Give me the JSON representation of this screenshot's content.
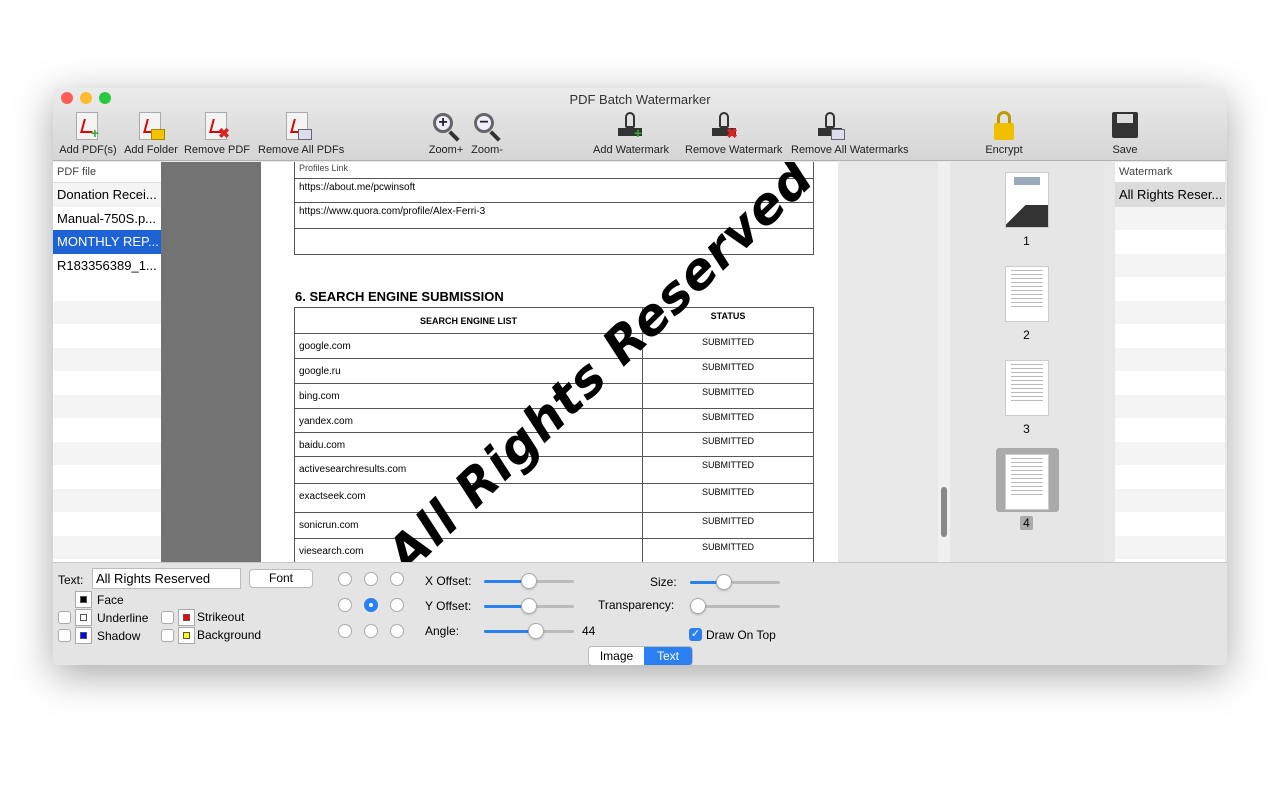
{
  "window": {
    "title": "PDF Batch Watermarker"
  },
  "toolbar": [
    {
      "label": "Add PDF(s)",
      "icon": "add-pdf-icon"
    },
    {
      "label": "Add Folder",
      "icon": "add-folder-icon"
    },
    {
      "label": "Remove PDF",
      "icon": "remove-pdf-icon"
    },
    {
      "label": "Remove All PDFs",
      "icon": "remove-all-pdfs-icon"
    },
    {
      "label": "Zoom+",
      "icon": "zoom-in-icon"
    },
    {
      "label": "Zoom-",
      "icon": "zoom-out-icon"
    },
    {
      "label": "Add Watermark",
      "icon": "add-watermark-icon"
    },
    {
      "label": "Remove Watermark",
      "icon": "remove-watermark-icon"
    },
    {
      "label": "Remove All Watermarks",
      "icon": "remove-all-watermarks-icon"
    },
    {
      "label": "Encrypt",
      "icon": "lock-icon"
    },
    {
      "label": "Save",
      "icon": "save-icon"
    }
  ],
  "pdf_list": {
    "header": "PDF file",
    "items": [
      "Donation Recei...",
      "Manual-750S.p...",
      "MONTHLY REP...",
      "R183356389_1..."
    ],
    "selected": 2
  },
  "preview": {
    "links": [
      "Profiles Link",
      "https://about.me/pcwinsoft",
      "https://www.quora.com/profile/Alex-Ferri-3"
    ],
    "section_title": "6.  SEARCH ENGINE SUBMISSION",
    "table_headers": [
      "SEARCH ENGINE LIST",
      "STATUS"
    ],
    "rows": [
      [
        "google.com",
        "SUBMITTED"
      ],
      [
        "google.ru",
        "SUBMITTED"
      ],
      [
        "bing.com",
        "SUBMITTED"
      ],
      [
        "yandex.com",
        "SUBMITTED"
      ],
      [
        "baidu.com",
        "SUBMITTED"
      ],
      [
        "activesearchresults.com",
        "SUBMITTED"
      ],
      [
        "exactseek.com",
        "SUBMITTED"
      ],
      [
        "sonicrun.com",
        "SUBMITTED"
      ],
      [
        "viesearch.com",
        "SUBMITTED"
      ]
    ],
    "watermark_text": "All Rights Reserved"
  },
  "thumbnails": {
    "pages": [
      "1",
      "2",
      "3",
      "4"
    ],
    "selected": 3
  },
  "watermark_list": {
    "header": "Watermark",
    "items": [
      "All Rights Reser..."
    ]
  },
  "settings": {
    "text_label": "Text:",
    "text_value": "All Rights Reserved",
    "font_button": "Font",
    "face": "Face",
    "underline": "Underline",
    "strikeout": "Strikeout",
    "shadow": "Shadow",
    "background": "Background",
    "colors": {
      "face": "#000000",
      "underline": "#ffffff",
      "strikeout": "#ff0000",
      "shadow": "#0000ff",
      "background": "#ffff00"
    },
    "position_selected": "middle-center",
    "x_offset_label": "X Offset:",
    "x_offset": 0.5,
    "y_offset_label": "Y Offset:",
    "y_offset": 0.5,
    "angle_label": "Angle:",
    "angle": "44",
    "angle_fraction": 0.6,
    "size_label": "Size:",
    "size": 0.35,
    "transparency_label": "Transparency:",
    "transparency": 0,
    "draw_on_top": "Draw On Top",
    "draw_on_top_checked": true
  },
  "mode_tabs": {
    "items": [
      "Image",
      "Text"
    ],
    "selected": "Text"
  }
}
